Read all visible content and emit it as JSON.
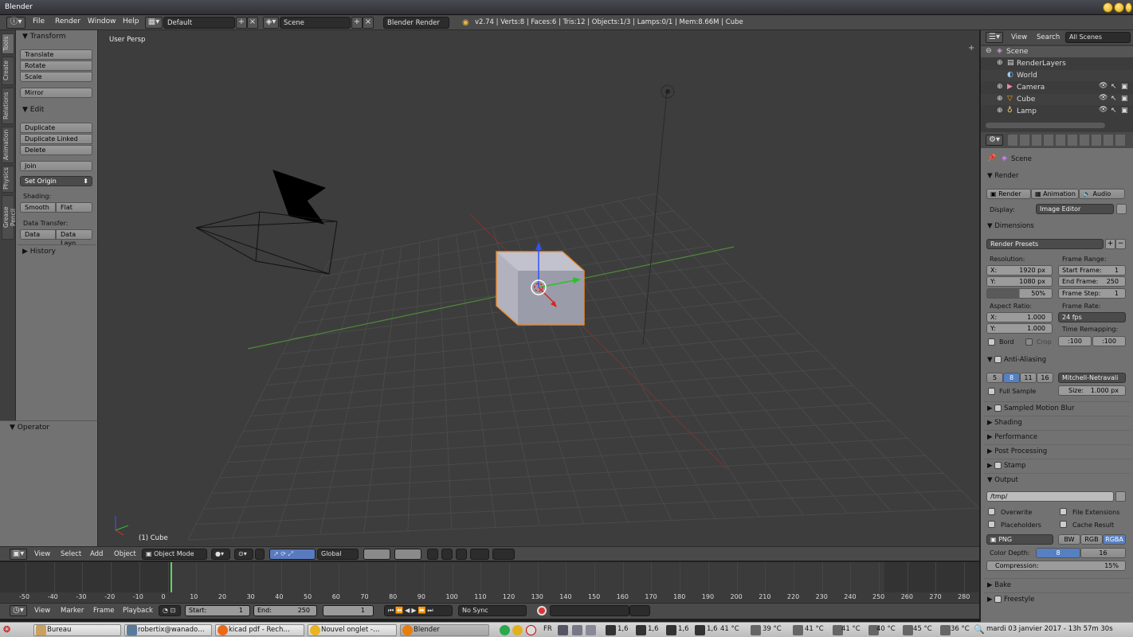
{
  "window": {
    "title": "Blender"
  },
  "top_menu": {
    "file": "File",
    "render": "Render",
    "window": "Window",
    "help": "Help"
  },
  "top_fields": {
    "layout": "Default",
    "scene": "Scene",
    "engine": "Blender Render",
    "stats": "v2.74 | Verts:8 | Faces:6 | Tris:12 | Objects:1/3 | Lamps:0/1 | Mem:8.66M | Cube"
  },
  "left_tabs": [
    "Tools",
    "Create",
    "Relations",
    "Animation",
    "Physics",
    "Grease Pencil"
  ],
  "tool_panel": {
    "transform_title": "Transform",
    "translate": "Translate",
    "rotate": "Rotate",
    "scale": "Scale",
    "mirror": "Mirror",
    "edit_title": "Edit",
    "duplicate": "Duplicate",
    "duplicate_linked": "Duplicate Linked",
    "delete": "Delete",
    "join": "Join",
    "set_origin": "Set Origin",
    "shading_label": "Shading:",
    "smooth": "Smooth",
    "flat": "Flat",
    "data_transfer_label": "Data Transfer:",
    "data": "Data",
    "data_layout": "Data Layo",
    "history_title": "History",
    "operator_title": "Operator"
  },
  "viewport": {
    "view_name": "User Persp",
    "object_label": "(1) Cube"
  },
  "view3d_header": {
    "view": "View",
    "select": "Select",
    "add": "Add",
    "object": "Object",
    "mode": "Object Mode",
    "orientation": "Global"
  },
  "timeline": {
    "ticks": [
      "-50",
      "-40",
      "-30",
      "-20",
      "-10",
      "0",
      "10",
      "20",
      "30",
      "40",
      "50",
      "60",
      "70",
      "80",
      "90",
      "100",
      "110",
      "120",
      "130",
      "140",
      "150",
      "160",
      "170",
      "180",
      "190",
      "200",
      "210",
      "220",
      "230",
      "240",
      "250",
      "260",
      "270",
      "280"
    ],
    "view": "View",
    "marker": "Marker",
    "frame": "Frame",
    "playback": "Playback",
    "start_label": "Start:",
    "start_value": "1",
    "end_label": "End:",
    "end_value": "250",
    "current_frame": "1",
    "sync": "No Sync"
  },
  "outliner": {
    "view": "View",
    "search": "Search",
    "filter": "All Scenes",
    "items": [
      {
        "label": "Scene"
      },
      {
        "label": "RenderLayers"
      },
      {
        "label": "World"
      },
      {
        "label": "Camera"
      },
      {
        "label": "Cube"
      },
      {
        "label": "Lamp"
      }
    ]
  },
  "properties": {
    "context": "Scene",
    "render_title": "Render",
    "render_btn": "Render",
    "animation_btn": "Animation",
    "audio_btn": "Audio",
    "display_label": "Display:",
    "display_value": "Image Editor",
    "dimensions_title": "Dimensions",
    "presets": "Render Presets",
    "resolution_label": "Resolution:",
    "res_x_label": "X:",
    "res_x": "1920 px",
    "res_y_label": "Y:",
    "res_y": "1080 px",
    "res_pct": "50%",
    "frame_range_label": "Frame Range:",
    "start_frame_label": "Start Frame:",
    "start_frame": "1",
    "end_frame_label": "End Frame:",
    "end_frame": "250",
    "frame_step_label": "Frame Step:",
    "frame_step": "1",
    "aspect_label": "Aspect Ratio:",
    "asp_x_label": "X:",
    "asp_x": "1.000",
    "asp_y_label": "Y:",
    "asp_y": "1.000",
    "frame_rate_label": "Frame Rate:",
    "frame_rate": "24 fps",
    "time_remap_label": "Time Remapping:",
    "remap_old": ":100",
    "remap_new": ":100",
    "bord": "Bord",
    "crop": "Crop",
    "aa_title": "Anti-Aliasing",
    "aa_samples": [
      "5",
      "8",
      "11",
      "16"
    ],
    "aa_filter": "Mitchell-Netravali",
    "full_sample": "Full Sample",
    "size_label": "Size:",
    "size_value": "1.000 px",
    "motion_blur_title": "Sampled Motion Blur",
    "shading_title": "Shading",
    "performance_title": "Performance",
    "post_title": "Post Processing",
    "stamp_title": "Stamp",
    "output_title": "Output",
    "output_path": "/tmp/",
    "overwrite": "Overwrite",
    "file_ext": "File Extensions",
    "placeholders": "Placeholders",
    "cache_result": "Cache Result",
    "format": "PNG",
    "bw": "BW",
    "rgb": "RGB",
    "rgba": "RGBA",
    "color_depth_label": "Color Depth:",
    "depth_8": "8",
    "depth_16": "16",
    "compression_label": "Compression:",
    "compression_value": "15%",
    "bake_title": "Bake",
    "freestyle_title": "Freestyle"
  },
  "taskbar": {
    "tasks": [
      "Bureau",
      "robertix@wanado…",
      "kicad pdf - Rech…",
      "Nouvel onglet -…",
      "Blender"
    ],
    "lang": "FR",
    "loads": [
      "1,6",
      "1,6",
      "1,6",
      "1,6"
    ],
    "temps": [
      "41 °C",
      "39 °C",
      "41 °C",
      "41 °C",
      "40 °C",
      "45 °C",
      "36 °C"
    ],
    "clock": "mardi 03 janvier 2017 - 13h 57m 30s"
  }
}
